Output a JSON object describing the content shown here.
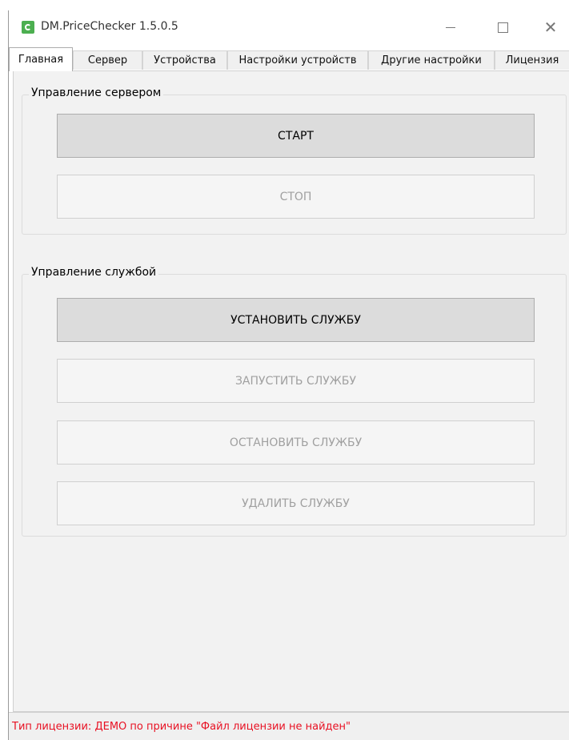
{
  "window": {
    "title": "DM.PriceChecker 1.5.0.5",
    "icon": "app-logo-icon",
    "controls": {
      "minimize": "minimize-icon",
      "maximize": "maximize-icon",
      "close": "close-icon"
    }
  },
  "tabs": [
    {
      "label": "Главная",
      "active": true
    },
    {
      "label": "Сервер",
      "active": false
    },
    {
      "label": "Устройства",
      "active": false
    },
    {
      "label": "Настройки устройств",
      "active": false
    },
    {
      "label": "Другие настройки",
      "active": false
    },
    {
      "label": "Лицензия",
      "active": false
    }
  ],
  "server_group": {
    "label": "Управление сервером",
    "buttons": [
      {
        "label": "СТАРТ",
        "enabled": true
      },
      {
        "label": "СТОП",
        "enabled": false
      }
    ]
  },
  "service_group": {
    "label": "Управление службой",
    "buttons": [
      {
        "label": "УСТАНОВИТЬ СЛУЖБУ",
        "enabled": true
      },
      {
        "label": "ЗАПУСТИТЬ СЛУЖБУ",
        "enabled": false
      },
      {
        "label": "ОСТАНОВИТЬ СЛУЖБУ",
        "enabled": false
      },
      {
        "label": "УДАЛИТЬ СЛУЖБУ",
        "enabled": false
      }
    ]
  },
  "status": {
    "text": "Тип лицензии: ДЕМО по причине \"Файл лицензии не найден\"",
    "color": "#e81123"
  }
}
